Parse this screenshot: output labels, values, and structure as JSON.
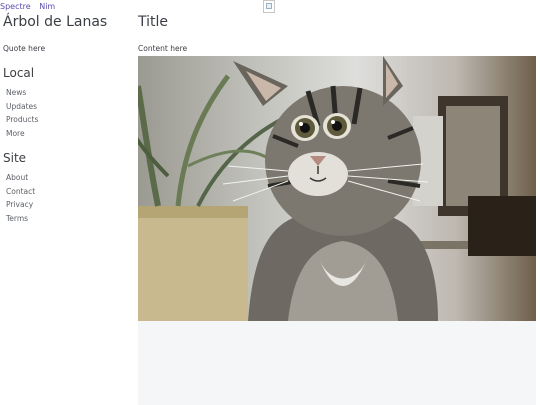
{
  "topnav": {
    "brand": "Spectre",
    "link": "Nim"
  },
  "sidebar": {
    "site_title": "Árbol de Lanas",
    "quote": "Quote here",
    "local": {
      "heading": "Local",
      "items": [
        {
          "label": "News"
        },
        {
          "label": "Updates"
        },
        {
          "label": "Products"
        },
        {
          "label": "More"
        }
      ]
    },
    "site": {
      "heading": "Site",
      "items": [
        {
          "label": "About"
        },
        {
          "label": "Contact"
        },
        {
          "label": "Privacy"
        },
        {
          "label": "Terms"
        }
      ]
    }
  },
  "main": {
    "title": "Title",
    "content": "Content here",
    "image": "tabby-kitten-photo"
  },
  "colors": {
    "link": "#5a4fb0",
    "text": "#3b3f45",
    "nav_link": "#5c6168",
    "panel_bg": "#f5f6f8"
  }
}
